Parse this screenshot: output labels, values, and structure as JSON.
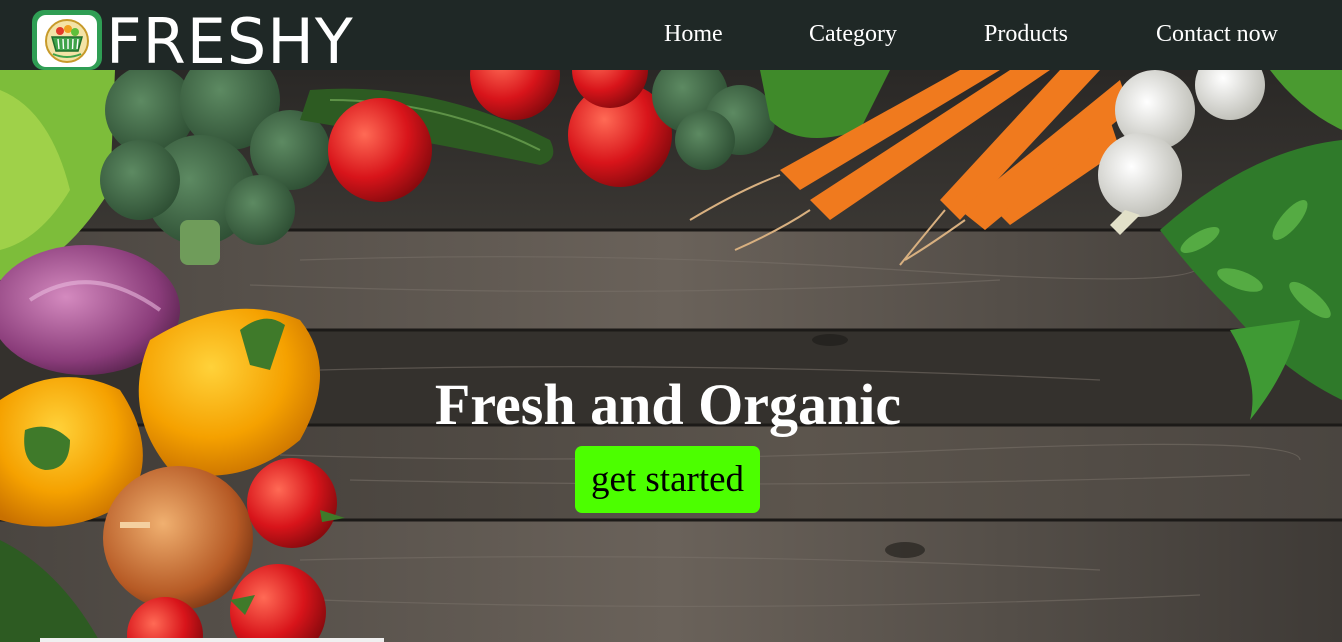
{
  "brand": {
    "name": "FRESHY",
    "logo": "grocery-basket-logo"
  },
  "nav": {
    "items": [
      {
        "label": "Home"
      },
      {
        "label": "Category"
      },
      {
        "label": "Products"
      },
      {
        "label": "Contact now"
      }
    ]
  },
  "hero": {
    "title": "Fresh and Organic",
    "cta_label": "get started",
    "background": "vegetables-on-wooden-table",
    "accent_color": "#4cff00"
  },
  "colors": {
    "navbar": "#1f2826",
    "logo_border": "#2f9e54"
  }
}
